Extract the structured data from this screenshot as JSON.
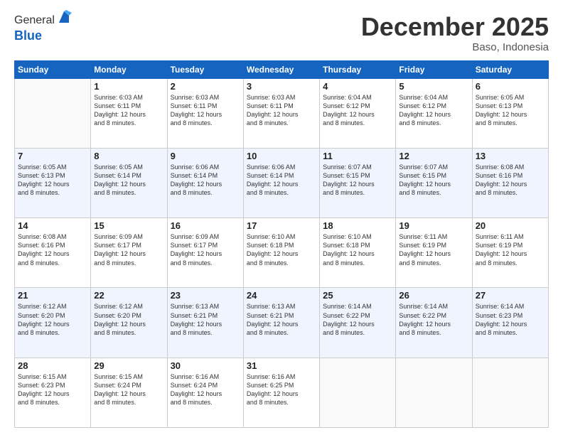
{
  "header": {
    "logo_general": "General",
    "logo_blue": "Blue",
    "month": "December 2025",
    "location": "Baso, Indonesia"
  },
  "columns": [
    "Sunday",
    "Monday",
    "Tuesday",
    "Wednesday",
    "Thursday",
    "Friday",
    "Saturday"
  ],
  "weeks": [
    [
      {
        "day": "",
        "info": ""
      },
      {
        "day": "1",
        "info": "Sunrise: 6:03 AM\nSunset: 6:11 PM\nDaylight: 12 hours\nand 8 minutes."
      },
      {
        "day": "2",
        "info": "Sunrise: 6:03 AM\nSunset: 6:11 PM\nDaylight: 12 hours\nand 8 minutes."
      },
      {
        "day": "3",
        "info": "Sunrise: 6:03 AM\nSunset: 6:11 PM\nDaylight: 12 hours\nand 8 minutes."
      },
      {
        "day": "4",
        "info": "Sunrise: 6:04 AM\nSunset: 6:12 PM\nDaylight: 12 hours\nand 8 minutes."
      },
      {
        "day": "5",
        "info": "Sunrise: 6:04 AM\nSunset: 6:12 PM\nDaylight: 12 hours\nand 8 minutes."
      },
      {
        "day": "6",
        "info": "Sunrise: 6:05 AM\nSunset: 6:13 PM\nDaylight: 12 hours\nand 8 minutes."
      }
    ],
    [
      {
        "day": "7",
        "info": "Sunrise: 6:05 AM\nSunset: 6:13 PM\nDaylight: 12 hours\nand 8 minutes."
      },
      {
        "day": "8",
        "info": "Sunrise: 6:05 AM\nSunset: 6:14 PM\nDaylight: 12 hours\nand 8 minutes."
      },
      {
        "day": "9",
        "info": "Sunrise: 6:06 AM\nSunset: 6:14 PM\nDaylight: 12 hours\nand 8 minutes."
      },
      {
        "day": "10",
        "info": "Sunrise: 6:06 AM\nSunset: 6:14 PM\nDaylight: 12 hours\nand 8 minutes."
      },
      {
        "day": "11",
        "info": "Sunrise: 6:07 AM\nSunset: 6:15 PM\nDaylight: 12 hours\nand 8 minutes."
      },
      {
        "day": "12",
        "info": "Sunrise: 6:07 AM\nSunset: 6:15 PM\nDaylight: 12 hours\nand 8 minutes."
      },
      {
        "day": "13",
        "info": "Sunrise: 6:08 AM\nSunset: 6:16 PM\nDaylight: 12 hours\nand 8 minutes."
      }
    ],
    [
      {
        "day": "14",
        "info": "Sunrise: 6:08 AM\nSunset: 6:16 PM\nDaylight: 12 hours\nand 8 minutes."
      },
      {
        "day": "15",
        "info": "Sunrise: 6:09 AM\nSunset: 6:17 PM\nDaylight: 12 hours\nand 8 minutes."
      },
      {
        "day": "16",
        "info": "Sunrise: 6:09 AM\nSunset: 6:17 PM\nDaylight: 12 hours\nand 8 minutes."
      },
      {
        "day": "17",
        "info": "Sunrise: 6:10 AM\nSunset: 6:18 PM\nDaylight: 12 hours\nand 8 minutes."
      },
      {
        "day": "18",
        "info": "Sunrise: 6:10 AM\nSunset: 6:18 PM\nDaylight: 12 hours\nand 8 minutes."
      },
      {
        "day": "19",
        "info": "Sunrise: 6:11 AM\nSunset: 6:19 PM\nDaylight: 12 hours\nand 8 minutes."
      },
      {
        "day": "20",
        "info": "Sunrise: 6:11 AM\nSunset: 6:19 PM\nDaylight: 12 hours\nand 8 minutes."
      }
    ],
    [
      {
        "day": "21",
        "info": "Sunrise: 6:12 AM\nSunset: 6:20 PM\nDaylight: 12 hours\nand 8 minutes."
      },
      {
        "day": "22",
        "info": "Sunrise: 6:12 AM\nSunset: 6:20 PM\nDaylight: 12 hours\nand 8 minutes."
      },
      {
        "day": "23",
        "info": "Sunrise: 6:13 AM\nSunset: 6:21 PM\nDaylight: 12 hours\nand 8 minutes."
      },
      {
        "day": "24",
        "info": "Sunrise: 6:13 AM\nSunset: 6:21 PM\nDaylight: 12 hours\nand 8 minutes."
      },
      {
        "day": "25",
        "info": "Sunrise: 6:14 AM\nSunset: 6:22 PM\nDaylight: 12 hours\nand 8 minutes."
      },
      {
        "day": "26",
        "info": "Sunrise: 6:14 AM\nSunset: 6:22 PM\nDaylight: 12 hours\nand 8 minutes."
      },
      {
        "day": "27",
        "info": "Sunrise: 6:14 AM\nSunset: 6:23 PM\nDaylight: 12 hours\nand 8 minutes."
      }
    ],
    [
      {
        "day": "28",
        "info": "Sunrise: 6:15 AM\nSunset: 6:23 PM\nDaylight: 12 hours\nand 8 minutes."
      },
      {
        "day": "29",
        "info": "Sunrise: 6:15 AM\nSunset: 6:24 PM\nDaylight: 12 hours\nand 8 minutes."
      },
      {
        "day": "30",
        "info": "Sunrise: 6:16 AM\nSunset: 6:24 PM\nDaylight: 12 hours\nand 8 minutes."
      },
      {
        "day": "31",
        "info": "Sunrise: 6:16 AM\nSunset: 6:25 PM\nDaylight: 12 hours\nand 8 minutes."
      },
      {
        "day": "",
        "info": ""
      },
      {
        "day": "",
        "info": ""
      },
      {
        "day": "",
        "info": ""
      }
    ]
  ]
}
